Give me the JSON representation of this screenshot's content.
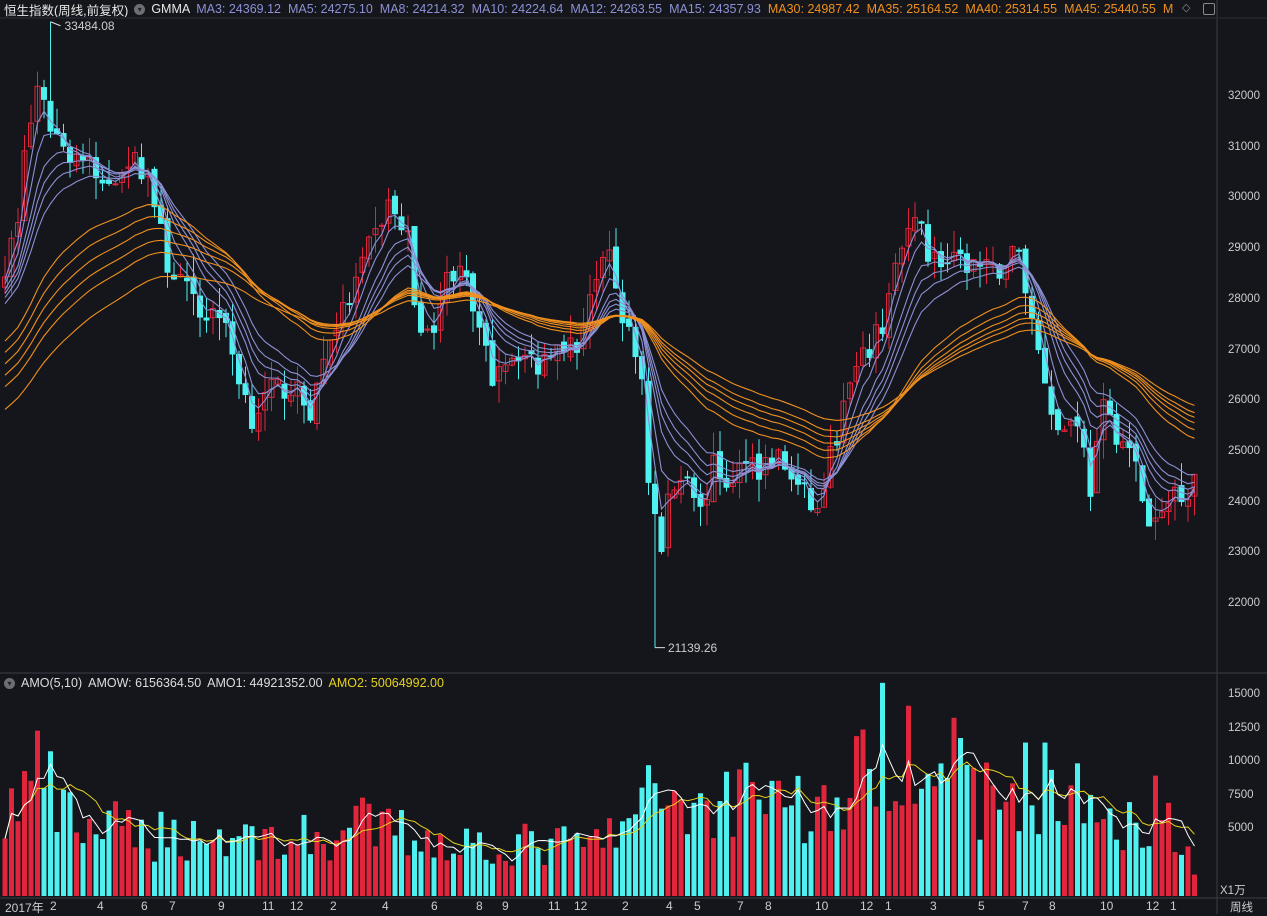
{
  "header": {
    "title": "恒生指数(周线,前复权)",
    "indicator": "GMMA",
    "ma_values": [
      {
        "label": "MA3: 24369.12",
        "group": "short"
      },
      {
        "label": "MA5: 24275.10",
        "group": "short"
      },
      {
        "label": "MA8: 24214.32",
        "group": "short"
      },
      {
        "label": "MA10: 24224.64",
        "group": "short"
      },
      {
        "label": "MA12: 24263.55",
        "group": "short"
      },
      {
        "label": "MA15: 24357.93",
        "group": "short"
      },
      {
        "label": "MA30: 24987.42",
        "group": "long"
      },
      {
        "label": "MA35: 25164.52",
        "group": "long"
      },
      {
        "label": "MA40: 25314.55",
        "group": "long"
      },
      {
        "label": "MA45: 25440.55",
        "group": "long"
      },
      {
        "label": "M",
        "group": "long"
      }
    ]
  },
  "sub_header": {
    "indicator": "AMO(5,10)",
    "amow": "AMOW: 6156364.50",
    "amo1": "AMO1: 44921352.00",
    "amo2": "AMO2: 50064992.00"
  },
  "colors": {
    "background": "#14161c",
    "up": "#e0253c",
    "down": "#4ef0f0",
    "short_ma": "#8d90d4",
    "long_ma": "#f0901e",
    "amo1": "#ffffff",
    "amo2": "#e6d21a"
  },
  "annotations": {
    "high": "33484.08",
    "low": "21139.26"
  },
  "axis": {
    "price_ticks": [
      "32000",
      "31000",
      "30000",
      "29000",
      "28000",
      "27000",
      "26000",
      "25000",
      "24000",
      "23000",
      "22000"
    ],
    "volume_ticks": [
      "15000",
      "12500",
      "10000",
      "7500",
      "5000"
    ],
    "volume_unit": "X1万",
    "period": "周线",
    "x_labels": [
      "2017年",
      "2",
      "4",
      "6",
      "7",
      "9",
      "11",
      "12",
      "2",
      "4",
      "6",
      "8",
      "9",
      "11",
      "12",
      "2",
      "4",
      "5",
      "7",
      "8",
      "10",
      "12",
      "1",
      "3",
      "5",
      "7",
      "8",
      "10",
      "12",
      "1"
    ]
  },
  "chart_data": {
    "type": "candlestick",
    "ma_periods_short": [
      3,
      5,
      8,
      10,
      12,
      15
    ],
    "ma_periods_long": [
      30,
      35,
      40,
      45,
      50,
      60
    ],
    "ylim": [
      21000,
      33500
    ],
    "volume_ylim": [
      0,
      15500
    ],
    "close_trace": [
      [
        0,
        28700
      ],
      [
        2,
        29500
      ],
      [
        3,
        31000
      ],
      [
        5,
        32000
      ],
      [
        7,
        31500
      ],
      [
        9,
        31000
      ],
      [
        12,
        30800
      ],
      [
        15,
        30200
      ],
      [
        19,
        30800
      ],
      [
        22,
        30500
      ],
      [
        25,
        28700
      ],
      [
        27,
        28400
      ],
      [
        30,
        27700
      ],
      [
        33,
        27800
      ],
      [
        36,
        26500
      ],
      [
        38,
        25700
      ],
      [
        41,
        26200
      ],
      [
        44,
        26300
      ],
      [
        47,
        25800
      ],
      [
        50,
        27300
      ],
      [
        53,
        28000
      ],
      [
        56,
        29000
      ],
      [
        59,
        29900
      ],
      [
        62,
        29200
      ],
      [
        63,
        28000
      ],
      [
        65,
        27200
      ],
      [
        68,
        28400
      ],
      [
        70,
        28800
      ],
      [
        72,
        27700
      ],
      [
        75,
        26500
      ],
      [
        76,
        26800
      ],
      [
        79,
        27000
      ],
      [
        82,
        26700
      ],
      [
        85,
        27300
      ],
      [
        88,
        27000
      ],
      [
        90,
        28200
      ],
      [
        93,
        28800
      ],
      [
        95,
        27700
      ],
      [
        98,
        26500
      ],
      [
        99,
        24500
      ],
      [
        101,
        23000
      ],
      [
        102,
        24100
      ],
      [
        105,
        24700
      ],
      [
        107,
        23800
      ],
      [
        109,
        24700
      ],
      [
        112,
        24300
      ],
      [
        114,
        25000
      ],
      [
        116,
        24700
      ],
      [
        119,
        24900
      ],
      [
        122,
        24300
      ],
      [
        125,
        23800
      ],
      [
        127,
        24900
      ],
      [
        130,
        26300
      ],
      [
        132,
        26800
      ],
      [
        135,
        27500
      ],
      [
        137,
        28700
      ],
      [
        139,
        29200
      ],
      [
        141,
        29700
      ],
      [
        142,
        28900
      ],
      [
        145,
        28700
      ],
      [
        149,
        28700
      ],
      [
        152,
        28500
      ],
      [
        155,
        28900
      ],
      [
        156,
        28900
      ],
      [
        158,
        27600
      ],
      [
        160,
        26500
      ],
      [
        162,
        25400
      ],
      [
        165,
        25700
      ],
      [
        167,
        24300
      ],
      [
        169,
        25800
      ],
      [
        172,
        25200
      ],
      [
        174,
        24700
      ],
      [
        176,
        23500
      ],
      [
        178,
        23700
      ],
      [
        180,
        24300
      ],
      [
        182,
        24200
      ],
      [
        183,
        24600
      ]
    ],
    "volume_trace": [
      [
        0,
        5800
      ],
      [
        3,
        8000
      ],
      [
        6,
        9500
      ],
      [
        8,
        6000
      ],
      [
        12,
        5200
      ],
      [
        20,
        4700
      ],
      [
        30,
        4500
      ],
      [
        40,
        4300
      ],
      [
        50,
        4200
      ],
      [
        55,
        5200
      ],
      [
        60,
        4800
      ],
      [
        70,
        4000
      ],
      [
        80,
        3800
      ],
      [
        90,
        3800
      ],
      [
        95,
        5000
      ],
      [
        100,
        7500
      ],
      [
        103,
        8000
      ],
      [
        106,
        6500
      ],
      [
        110,
        6800
      ],
      [
        115,
        9000
      ],
      [
        120,
        7500
      ],
      [
        125,
        6000
      ],
      [
        130,
        8000
      ],
      [
        135,
        11000
      ],
      [
        140,
        12500
      ],
      [
        143,
        11500
      ],
      [
        148,
        8000
      ],
      [
        152,
        7000
      ],
      [
        157,
        8500
      ],
      [
        162,
        8000
      ],
      [
        167,
        6500
      ],
      [
        172,
        6000
      ],
      [
        178,
        6500
      ],
      [
        181,
        5500
      ],
      [
        183,
        1200
      ]
    ]
  }
}
